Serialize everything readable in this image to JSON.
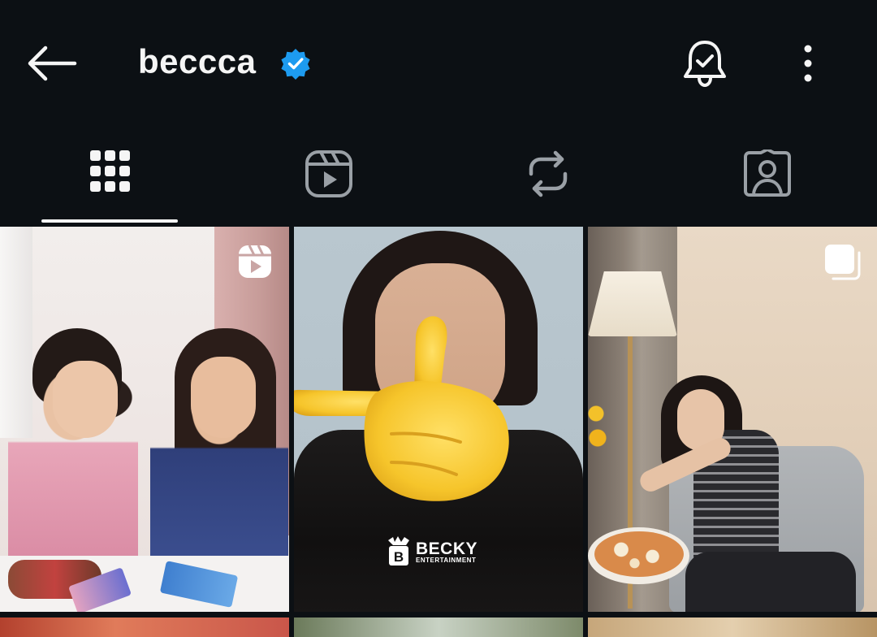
{
  "header": {
    "username": "beccca",
    "verified": true,
    "icons": {
      "back": "back-arrow-icon",
      "verified": "verified-badge-icon",
      "notifications": "bell-check-icon",
      "more": "more-vertical-icon"
    }
  },
  "tabs": [
    {
      "name": "posts",
      "icon": "grid-icon",
      "active": true
    },
    {
      "name": "reels",
      "icon": "reels-icon",
      "active": false
    },
    {
      "name": "reposts",
      "icon": "repost-icon",
      "active": false
    },
    {
      "name": "tagged",
      "icon": "tagged-user-icon",
      "active": false
    }
  ],
  "posts": [
    {
      "type": "reel",
      "badge_icon": "reels-badge-icon"
    },
    {
      "type": "photo",
      "badge_icon": null,
      "watermark": {
        "brand": "BECKY",
        "sub": "ENTERTAINMENT"
      },
      "sticker": "pointing-hand-emoji"
    },
    {
      "type": "carousel",
      "badge_icon": "carousel-badge-icon"
    }
  ],
  "colors": {
    "background": "#0c1014",
    "foreground": "#f5f5f5",
    "verified": "#1d9bf0",
    "tab_inactive": "#9aa0a6"
  }
}
